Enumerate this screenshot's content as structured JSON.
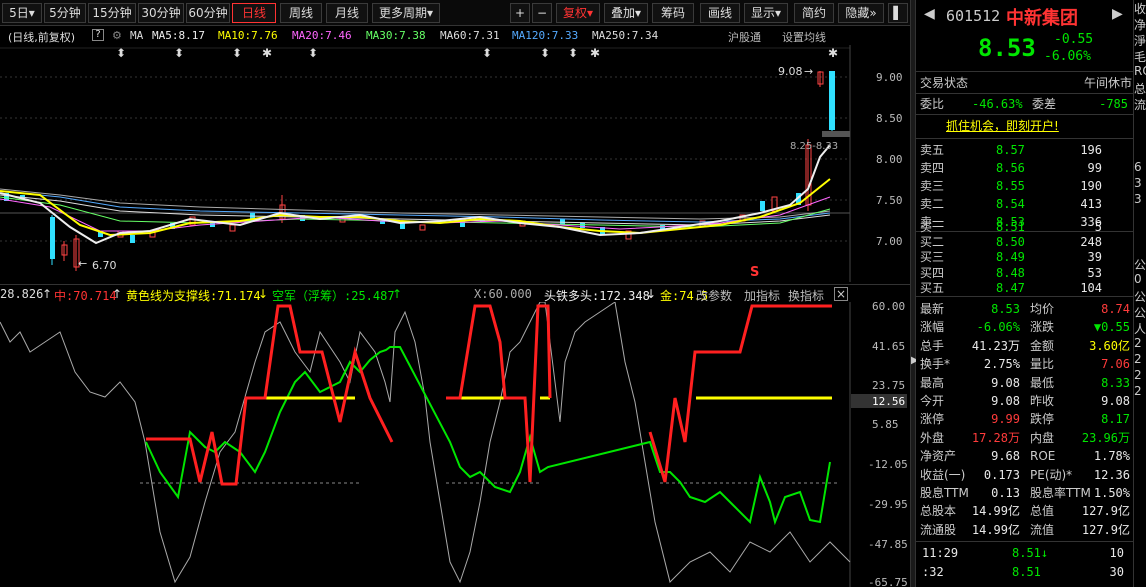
{
  "toolbar": {
    "periods": [
      "5日",
      "5分钟",
      "15分钟",
      "30分钟",
      "60分钟",
      "日线",
      "周线",
      "月线",
      "更多周期"
    ],
    "active_period": "日线",
    "right": {
      "plus": "+",
      "minus": "−",
      "fuquan": "复权",
      "diejia": "叠加",
      "chouma": "筹码",
      "huaxian": "画线",
      "xianshi": "显示",
      "jianyue": "简约",
      "yincang": "隐藏"
    }
  },
  "ma_line": {
    "period_label": "(日线,前复权)",
    "help": "?",
    "ma_prefix": "MA",
    "ma5": "MA5:8.17",
    "ma10": "MA10:7.76",
    "ma20": "MA20:7.46",
    "ma30": "MA30:7.38",
    "ma60": "MA60:7.31",
    "ma120": "MA120:7.33",
    "ma250": "MA250:7.34",
    "hugutong": "沪股通",
    "set_ma": "设置均线"
  },
  "kline": {
    "y_ticks": [
      "9.00",
      "8.50",
      "8.00",
      "7.50",
      "7.00"
    ],
    "high_label": "9.08",
    "low_label": "6.70",
    "cross_label": "8.25-8.33",
    "s_marker": "S",
    "down_marker": "⬍",
    "star_marker": "✱"
  },
  "indicator": {
    "v1": "28.826",
    "zhong": "中:70.714",
    "yellow_line": "黄色线为支撑线:71.174",
    "kongjun": "空军（浮筹）:25.487",
    "x": "X:60.000",
    "toutie": "头铁多头:172.348",
    "jin": "金:74.5",
    "gai": "改参数",
    "jia": "加指标",
    "huan": "换指标",
    "close": "×",
    "y_ticks": [
      "60.00",
      "41.65",
      "23.75",
      "5.85",
      "-12.05",
      "-29.95",
      "-47.85",
      "-65.75"
    ],
    "highlight": "12.56"
  },
  "panel": {
    "code": "601512",
    "name": "中新集团",
    "price": "8.53",
    "change": "-0.55",
    "change_pct": "-6.06%",
    "trade_status_label": "交易状态",
    "trade_status_value": "午间休市",
    "weibi_label": "委比",
    "weibi_value": "-46.63%",
    "weicha_label": "委差",
    "weicha_value": "-785",
    "promo": "抓住机会，即刻开户!",
    "asks": [
      {
        "label": "卖五",
        "price": "8.57",
        "vol": "196"
      },
      {
        "label": "卖四",
        "price": "8.56",
        "vol": "99"
      },
      {
        "label": "卖三",
        "price": "8.55",
        "vol": "190"
      },
      {
        "label": "卖二",
        "price": "8.54",
        "vol": "413"
      },
      {
        "label": "卖一",
        "price": "8.53",
        "vol": "336"
      }
    ],
    "bids": [
      {
        "label": "买一",
        "price": "8.51",
        "vol": "5"
      },
      {
        "label": "买二",
        "price": "8.50",
        "vol": "248"
      },
      {
        "label": "买三",
        "price": "8.49",
        "vol": "39"
      },
      {
        "label": "买四",
        "price": "8.48",
        "vol": "53"
      },
      {
        "label": "买五",
        "price": "8.47",
        "vol": "104"
      }
    ],
    "stats": [
      {
        "l1": "最新",
        "v1": "8.53",
        "c1": "green",
        "l2": "均价",
        "v2": "8.74",
        "c2": "red"
      },
      {
        "l1": "涨幅",
        "v1": "-6.06%",
        "c1": "green",
        "l2": "涨跌",
        "v2": "▼0.55",
        "c2": "green"
      },
      {
        "l1": "总手",
        "v1": "41.23万",
        "c1": "white",
        "l2": "金额",
        "v2": "3.60亿",
        "c2": "yellow"
      },
      {
        "l1": "换手*",
        "v1": "2.75%",
        "c1": "white",
        "l2": "量比",
        "v2": "7.06",
        "c2": "red"
      },
      {
        "l1": "最高",
        "v1": "9.08",
        "c1": "white",
        "l2": "最低",
        "v2": "8.33",
        "c2": "green"
      },
      {
        "l1": "今开",
        "v1": "9.08",
        "c1": "white",
        "l2": "昨收",
        "v2": "9.08",
        "c2": "white"
      },
      {
        "l1": "涨停",
        "v1": "9.99",
        "c1": "red",
        "l2": "跌停",
        "v2": "8.17",
        "c2": "green"
      },
      {
        "l1": "外盘",
        "v1": "17.28万",
        "c1": "red",
        "l2": "内盘",
        "v2": "23.96万",
        "c2": "green"
      },
      {
        "l1": "净资产",
        "v1": "9.68",
        "c1": "white",
        "l2": "ROE",
        "v2": "1.78%",
        "c2": "white"
      },
      {
        "l1": "收益(一)",
        "v1": "0.173",
        "c1": "white",
        "l2": "PE(动)*",
        "v2": "12.36",
        "c2": "white"
      },
      {
        "l1": "股息TTM",
        "v1": "0.13",
        "c1": "white",
        "l2": "股息率TTM",
        "v2": "1.50%",
        "c2": "white"
      },
      {
        "l1": "总股本",
        "v1": "14.99亿",
        "c1": "white",
        "l2": "总值",
        "v2": "127.9亿",
        "c2": "white"
      },
      {
        "l1": "流通股",
        "v1": "14.99亿",
        "c1": "white",
        "l2": "流值",
        "v2": "127.9亿",
        "c2": "white"
      }
    ],
    "ticks": [
      {
        "time": "11:29",
        "price": "8.51↓",
        "vol": "10"
      },
      {
        "time": ":32",
        "price": "8.51",
        "vol": "30"
      }
    ]
  },
  "edge_chars": [
    "收",
    "净",
    "淨",
    "毛",
    "RO",
    "总",
    "流",
    "",
    "",
    "",
    "6",
    "3",
    "3",
    "",
    "",
    "",
    "公",
    "0",
    "公",
    "公",
    "人",
    "2",
    "2",
    "2",
    "2"
  ]
}
